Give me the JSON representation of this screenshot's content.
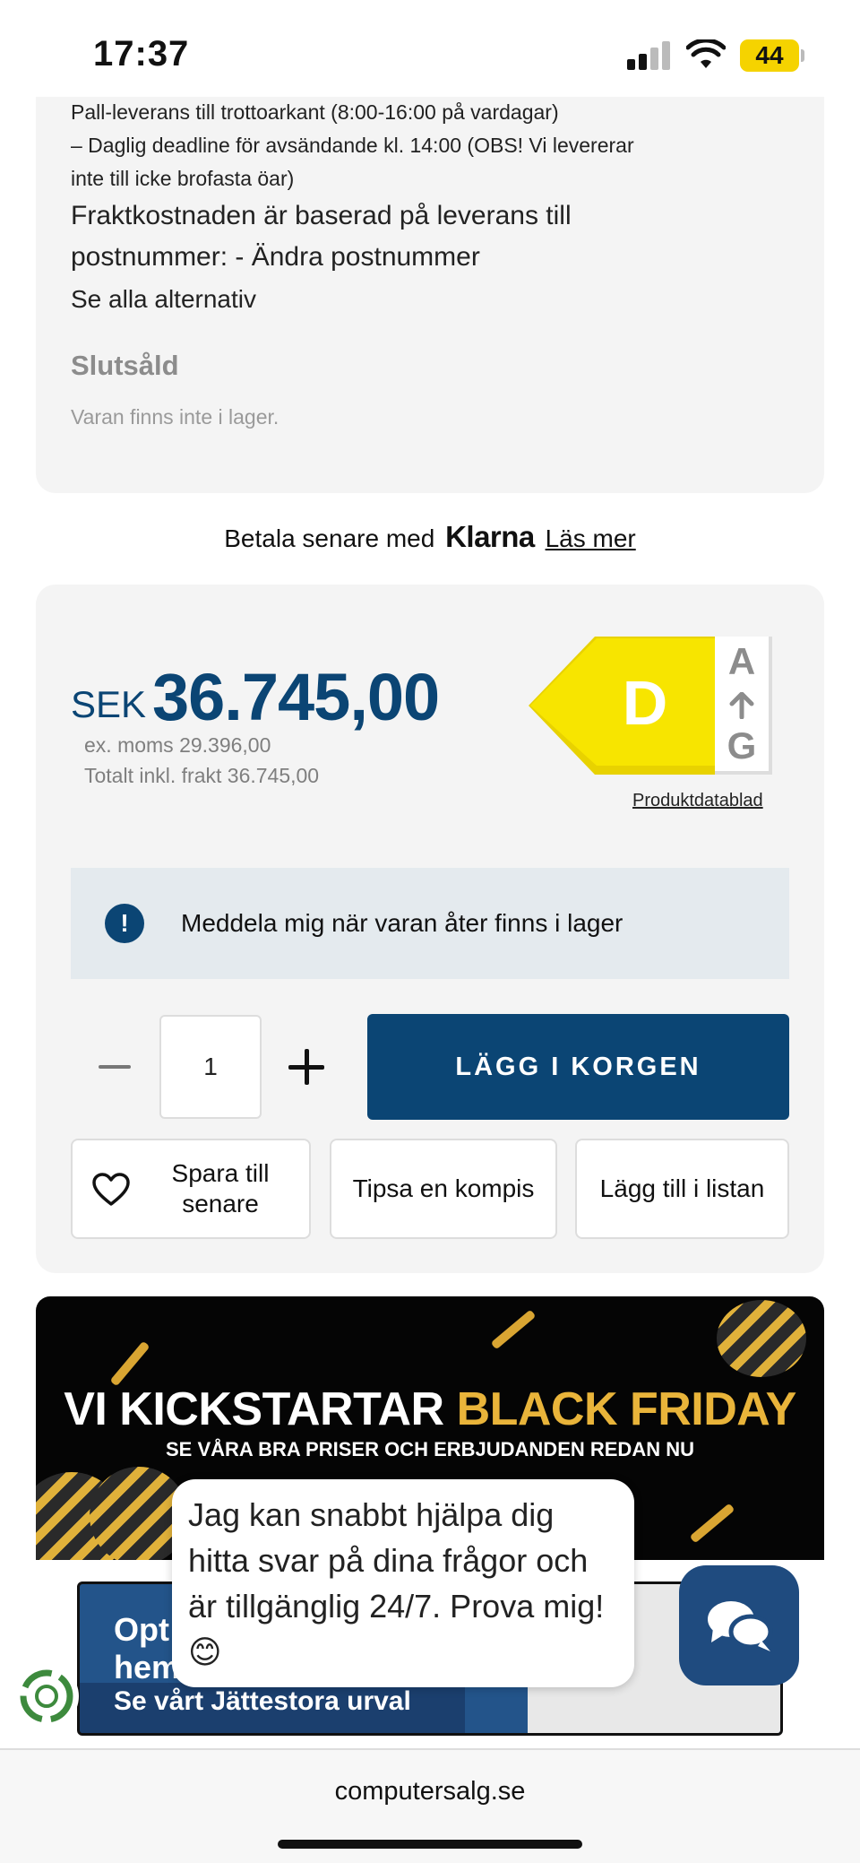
{
  "status_bar": {
    "time": "17:37",
    "battery_level": "44",
    "icons": [
      "signal-icon",
      "wifi-icon",
      "battery-icon"
    ]
  },
  "shipping": {
    "lines": [
      "Pall-leverans till trottoarkant (8:00-16:00 på vardagar)",
      "– Daglig deadline för avsändande kl. 14:00 (OBS! Vi levererar",
      "inte till icke brofasta öar)"
    ],
    "cost_line_1": "Fraktkostnaden är baserad på leverans till",
    "cost_line_2": "postnummer: - Ändra postnummer",
    "see_all": "Se alla alternativ",
    "stock_status": "Slutsåld",
    "stock_note": "Varan finns inte i lager."
  },
  "klarna": {
    "prefix": "Betala senare med",
    "brand": "Klarna",
    "link": "Läs mer"
  },
  "price": {
    "currency": "SEK",
    "amount": "36.745,00",
    "ex_vat": "ex. moms 29.396,00",
    "total_incl_shipping": "Totalt inkl. frakt 36.745,00"
  },
  "energy_label": {
    "class": "D",
    "scale_top": "A",
    "scale_bottom": "G",
    "color": "#f7e500",
    "datasheet_link": "Produktdatablad"
  },
  "notify": {
    "icon": "alert-icon",
    "text": "Meddela mig när varan åter finns i lager"
  },
  "cart": {
    "quantity": "1",
    "add_to_cart": "LÄGG I KORGEN"
  },
  "actions": {
    "save_line_1": "Spara till",
    "save_line_2": "senare",
    "tips": "Tipsa en kompis",
    "add_to_list": "Lägg till i listan"
  },
  "banner": {
    "title_white": "VI KICKSTARTAR",
    "title_gold": "BLACK FRIDAY",
    "subtitle": "SE VÅRA BRA PRISER OCH ERBJUDANDEN REDAN NU"
  },
  "banner2": {
    "text_1": "Opt",
    "text_1b": "hem",
    "text_2": "Se vårt Jättestora urval"
  },
  "chat": {
    "message": "Jag kan snabbt hjälpa dig hitta svar på dina frågor och är tillgänglig 24/7. Prova mig! 😊"
  },
  "browser": {
    "url": "computersalg.se"
  },
  "colors": {
    "brand_blue": "#0b4574",
    "card_bg": "#f4f4f4",
    "banner_gold": "#e9b43a"
  }
}
